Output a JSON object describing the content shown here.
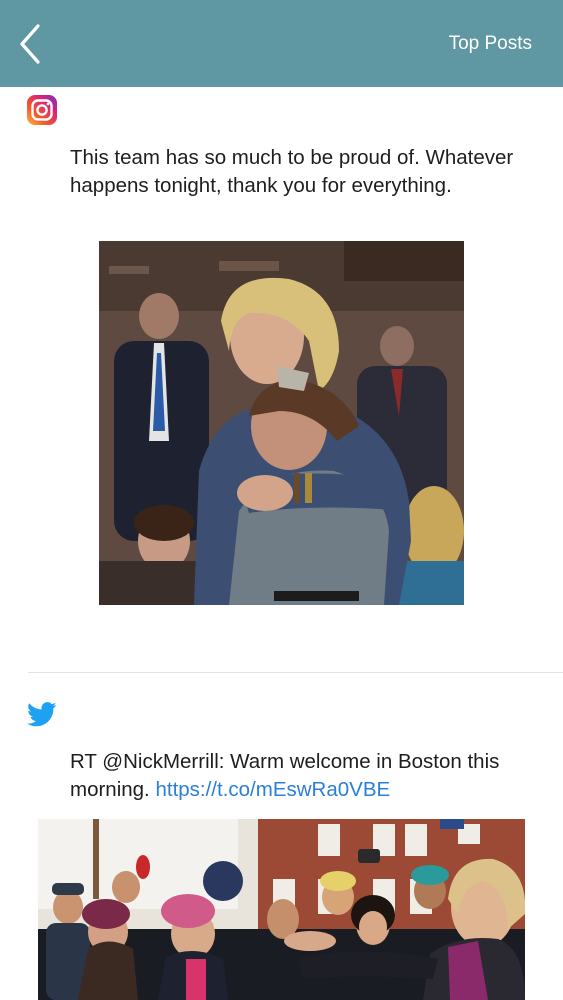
{
  "nav": {
    "title": "Top Posts",
    "back_icon": "chevron-left-icon",
    "background": "#5f98a2"
  },
  "posts": [
    {
      "source": "instagram",
      "icon": "instagram-icon",
      "text": "This team has so much to be proud of. Whatever happens tonight, thank you for everything.",
      "photo": "photo-embrace"
    },
    {
      "source": "twitter",
      "icon": "twitter-icon",
      "text": "RT @NickMerrill: Warm welcome in Boston this morning.",
      "link": "https://t.co/mEswRa0VBE",
      "link_color": "#2a7fd8",
      "photo": "photo-crowd"
    }
  ]
}
